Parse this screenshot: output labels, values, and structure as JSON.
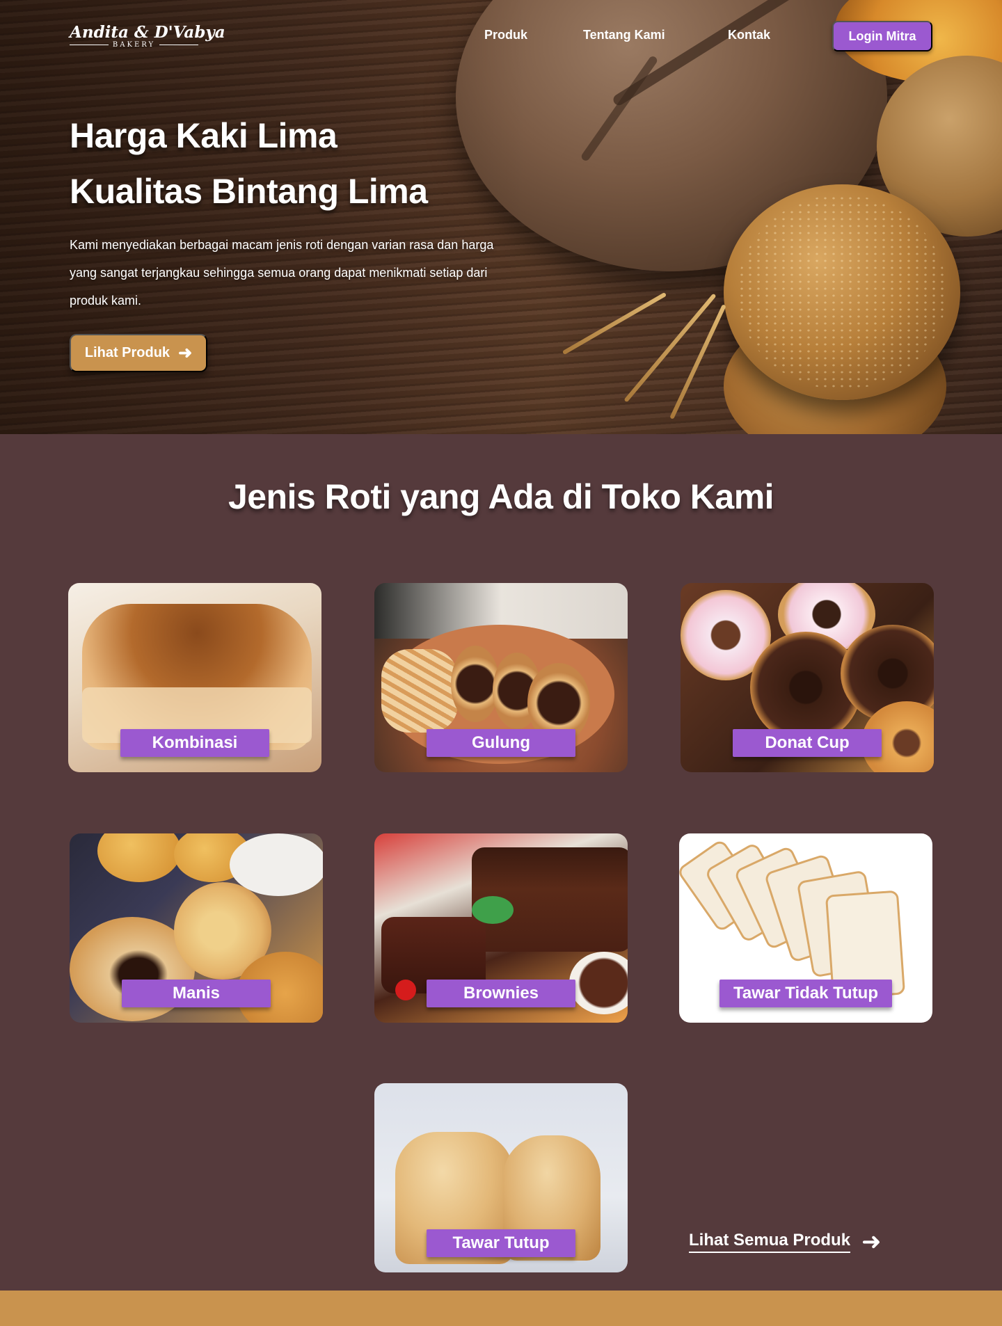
{
  "brand": {
    "script": "Andita & D'Vabya",
    "sub": "BAKERY"
  },
  "nav": {
    "links": [
      "Produk",
      "Tentang Kami",
      "Kontak"
    ],
    "login": "Login Mitra"
  },
  "hero": {
    "title_line1": "Harga Kaki Lima",
    "title_line2": "Kualitas Bintang Lima",
    "description": "Kami menyediakan berbagai macam jenis roti dengan varian rasa dan harga yang sangat terjangkau sehingga semua orang dapat menikmati setiap dari produk kami.",
    "cta": "Lihat Produk",
    "cta_icon": "arrow-right-icon"
  },
  "products": {
    "title": "Jenis Roti yang Ada di Toko Kami",
    "items": [
      {
        "label": "Kombinasi"
      },
      {
        "label": "Gulung"
      },
      {
        "label": "Donat Cup"
      },
      {
        "label": "Manis"
      },
      {
        "label": "Brownies"
      },
      {
        "label": "Tawar Tidak Tutup"
      },
      {
        "label": "Tawar Tutup"
      }
    ],
    "see_all": "Lihat Semua Produk",
    "see_all_icon": "arrow-right-icon"
  },
  "colors": {
    "background": "#553a3c",
    "accent_purple": "#9b59d0",
    "accent_gold": "#c9934e"
  }
}
